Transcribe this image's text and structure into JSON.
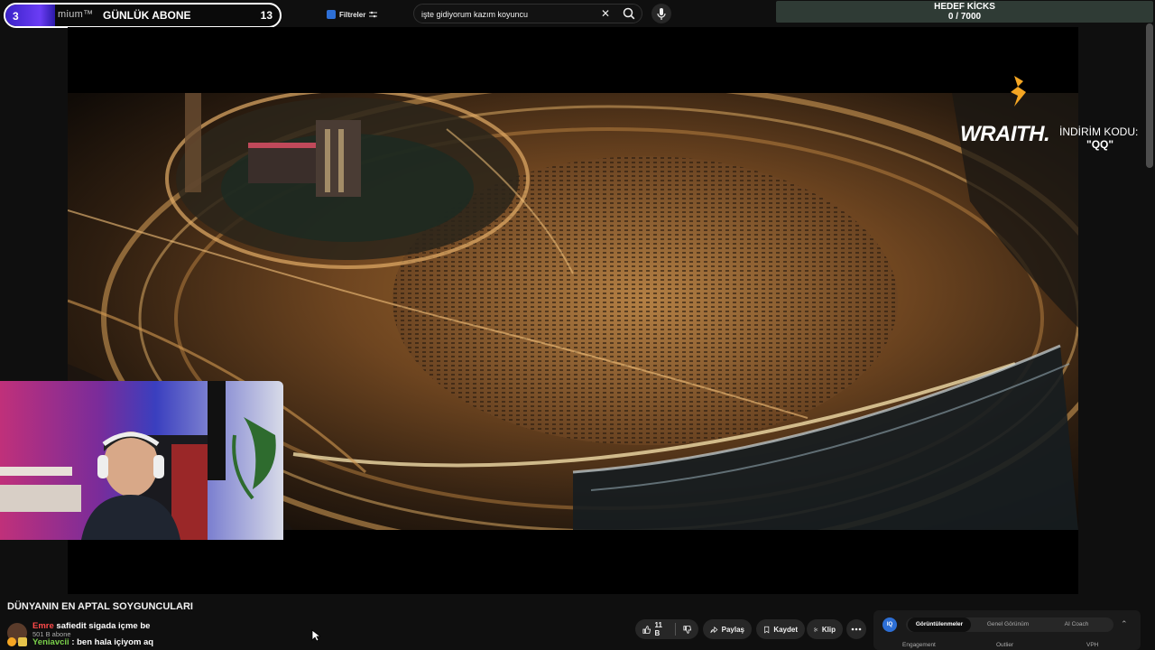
{
  "subscriber_goal": {
    "start": "3",
    "brand_text": "mium™",
    "label": "GÜNLÜK ABONE",
    "end": "13",
    "progress": 0.18
  },
  "filter_button": {
    "label": "Filtreler"
  },
  "search": {
    "value": "işte gidiyorum kazım koyuncu",
    "clear_label": "✕"
  },
  "kicks_goal": {
    "title": "HEDEF KİCKS",
    "value": "0 / 7000"
  },
  "sponsor": {
    "brand": "WRAITH.",
    "code_label": "İNDİRİM KODU:",
    "code": "\"QQ\""
  },
  "video": {
    "title": "DÜNYANIN EN APTAL SOYGUNCULARI"
  },
  "channel": {
    "subs": "501 B abone"
  },
  "chat": [
    {
      "user": "Emre",
      "message": "safiedit sigada içme be"
    },
    {
      "user": "Yeniavcii",
      "message": ": ben hala içiyom aq"
    }
  ],
  "actions": {
    "like_count": "11 B",
    "share": "Paylaş",
    "save": "Kaydet",
    "clip": "Klip"
  },
  "extension": {
    "logo": "IQ",
    "tabs": [
      "Görüntülenmeler",
      "Genel Görünüm",
      "AI Coach"
    ],
    "active_tab": 0,
    "columns": [
      "Engagement",
      "Outlier",
      "VPH"
    ]
  },
  "colors": {
    "goal_fill": "#5a33e8",
    "kicks_bg": "#2f3b35",
    "chat_user_1": "#ff4a4a",
    "chat_user_2": "#7ad14a",
    "sponsor_accent": "#f5a623"
  }
}
